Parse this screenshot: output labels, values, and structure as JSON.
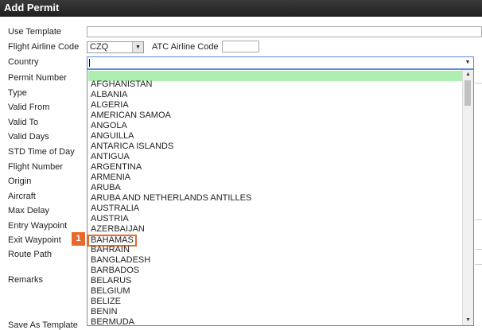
{
  "window": {
    "title": "Add Permit"
  },
  "form": {
    "use_template_label": "Use Template",
    "flight_airline_code_label": "Flight Airline Code",
    "flight_airline_code_value": "CZQ",
    "atc_airline_code_label": "ATC Airline Code",
    "country_label": "Country",
    "permit_number_label": "Permit Number",
    "type_label": "Type",
    "valid_from_label": "Valid From",
    "valid_to_label": "Valid To",
    "valid_days_label": "Valid Days",
    "std_time_label": "STD Time of Day",
    "flight_number_label": "Flight Number",
    "origin_label": "Origin",
    "aircraft_label": "Aircraft",
    "max_delay_label": "Max Delay",
    "entry_waypoint_label": "Entry Waypoint",
    "exit_waypoint_label": "Exit Waypoint",
    "route_path_label": "Route Path",
    "remarks_label": "Remarks",
    "save_as_template_label": "Save As Template"
  },
  "country_dropdown": {
    "options": [
      "AFGHANISTAN",
      "ALBANIA",
      "ALGERIA",
      "AMERICAN SAMOA",
      "ANGOLA",
      "ANGUILLA",
      "ANTARICA ISLANDS",
      "ANTIGUA",
      "ARGENTINA",
      "ARMENIA",
      "ARUBA",
      "ARUBA AND NETHERLANDS ANTILLES",
      "AUSTRALIA",
      "AUSTRIA",
      "AZERBAIJAN",
      "BAHAMAS",
      "BAHRAIN",
      "BANGLADESH",
      "BARBADOS",
      "BELARUS",
      "BELGIUM",
      "BELIZE",
      "BENIN",
      "BERMUDA"
    ],
    "marked_option": "BAHAMAS"
  },
  "annotation": {
    "step_number": "1",
    "color": "#e8692a"
  }
}
